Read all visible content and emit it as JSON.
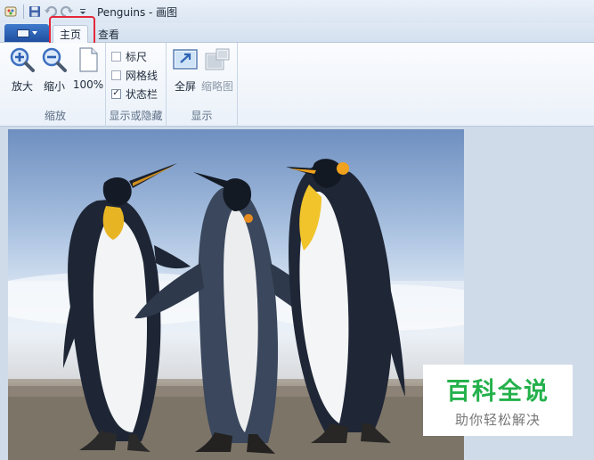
{
  "window": {
    "title": "Penguins - 画图"
  },
  "tabs": [
    {
      "label": "主页",
      "active": true
    },
    {
      "label": "查看",
      "active": false
    }
  ],
  "ribbon": {
    "zoom_group": {
      "label": "缩放",
      "zoom_in": "放大",
      "zoom_out": "缩小",
      "actual_size": "100%"
    },
    "show_hide_group": {
      "label": "显示或隐藏",
      "rulers": {
        "label": "标尺",
        "checked": false
      },
      "gridlines": {
        "label": "网格线",
        "checked": false
      },
      "statusbar": {
        "label": "状态栏",
        "checked": true
      }
    },
    "display_group": {
      "label": "显示",
      "fullscreen": "全屏",
      "thumbnail": "缩略图"
    }
  },
  "watermark": {
    "title": "百科全说",
    "subtitle": "助你轻松解决"
  },
  "colors": {
    "highlight": "#e5283a",
    "watermark_green": "#24b14b",
    "app_button": "#2a5fb4"
  },
  "icons": {
    "save": "save-icon",
    "undo": "undo-icon",
    "redo": "redo-icon",
    "zoom_in": "zoom-in-icon",
    "zoom_out": "zoom-out-icon",
    "page": "page-icon",
    "fullscreen": "fullscreen-icon",
    "thumbnail": "thumbnail-icon"
  }
}
